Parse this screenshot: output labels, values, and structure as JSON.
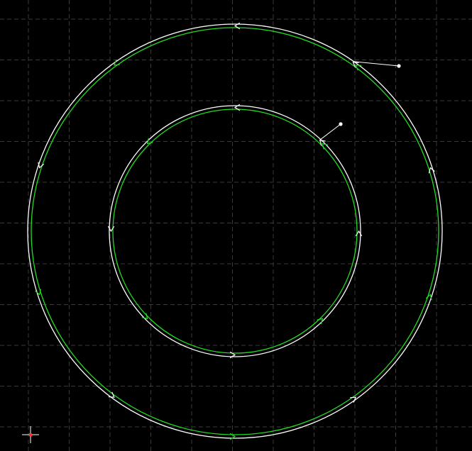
{
  "colors": {
    "background": "#000000",
    "grid": "#3a3a3a",
    "contour": "#ffffff",
    "toolpath": "#22dd22",
    "lead_in": "#ffffff",
    "cursor_cross": "#ffffff",
    "cursor_center": "#ff3030"
  },
  "icons": {
    "direction_arrow": "chevron-arrow-icon",
    "lead_in_point": "lead-in-dot-icon",
    "cursor": "crosshair-cursor-icon"
  },
  "grid": {
    "visible": true,
    "style": "dashed"
  },
  "contours": [
    {
      "name": "outer-circle",
      "arrow_count": 10
    },
    {
      "name": "inner-circle",
      "arrow_count": 8
    }
  ]
}
